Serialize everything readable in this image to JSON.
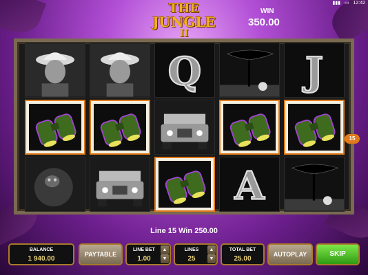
{
  "logo": {
    "line1": "THE",
    "line2": "JUNGLE",
    "line3": "II"
  },
  "win": {
    "label": "WIN",
    "value": "350.00"
  },
  "status": {
    "time": "12:42"
  },
  "reels": [
    [
      "explorer",
      "binoculars",
      "gorilla"
    ],
    [
      "explorer",
      "binoculars",
      "jeep"
    ],
    [
      "Q",
      "jeep",
      "binoculars"
    ],
    [
      "tree-sunset",
      "binoculars",
      "A"
    ],
    [
      "J",
      "binoculars",
      "tree-sunset"
    ]
  ],
  "line_marker": "15",
  "message": "Line 15 Win 250.00",
  "controls": {
    "balance_label": "BALANCE",
    "balance_value": "1 940.00",
    "paytable_label": "PAYTABLE",
    "linebet_label": "LINE BET",
    "linebet_value": "1.00",
    "lines_label": "LINES",
    "lines_value": "25",
    "totalbet_label": "TOTAL BET",
    "totalbet_value": "25.00",
    "autoplay_label": "AUTOPLAY",
    "skip_label": "SKIP"
  },
  "colors": {
    "win_border": "#e07a1a",
    "accent_gold": "#f0b020",
    "purple": "#b24fd6"
  }
}
